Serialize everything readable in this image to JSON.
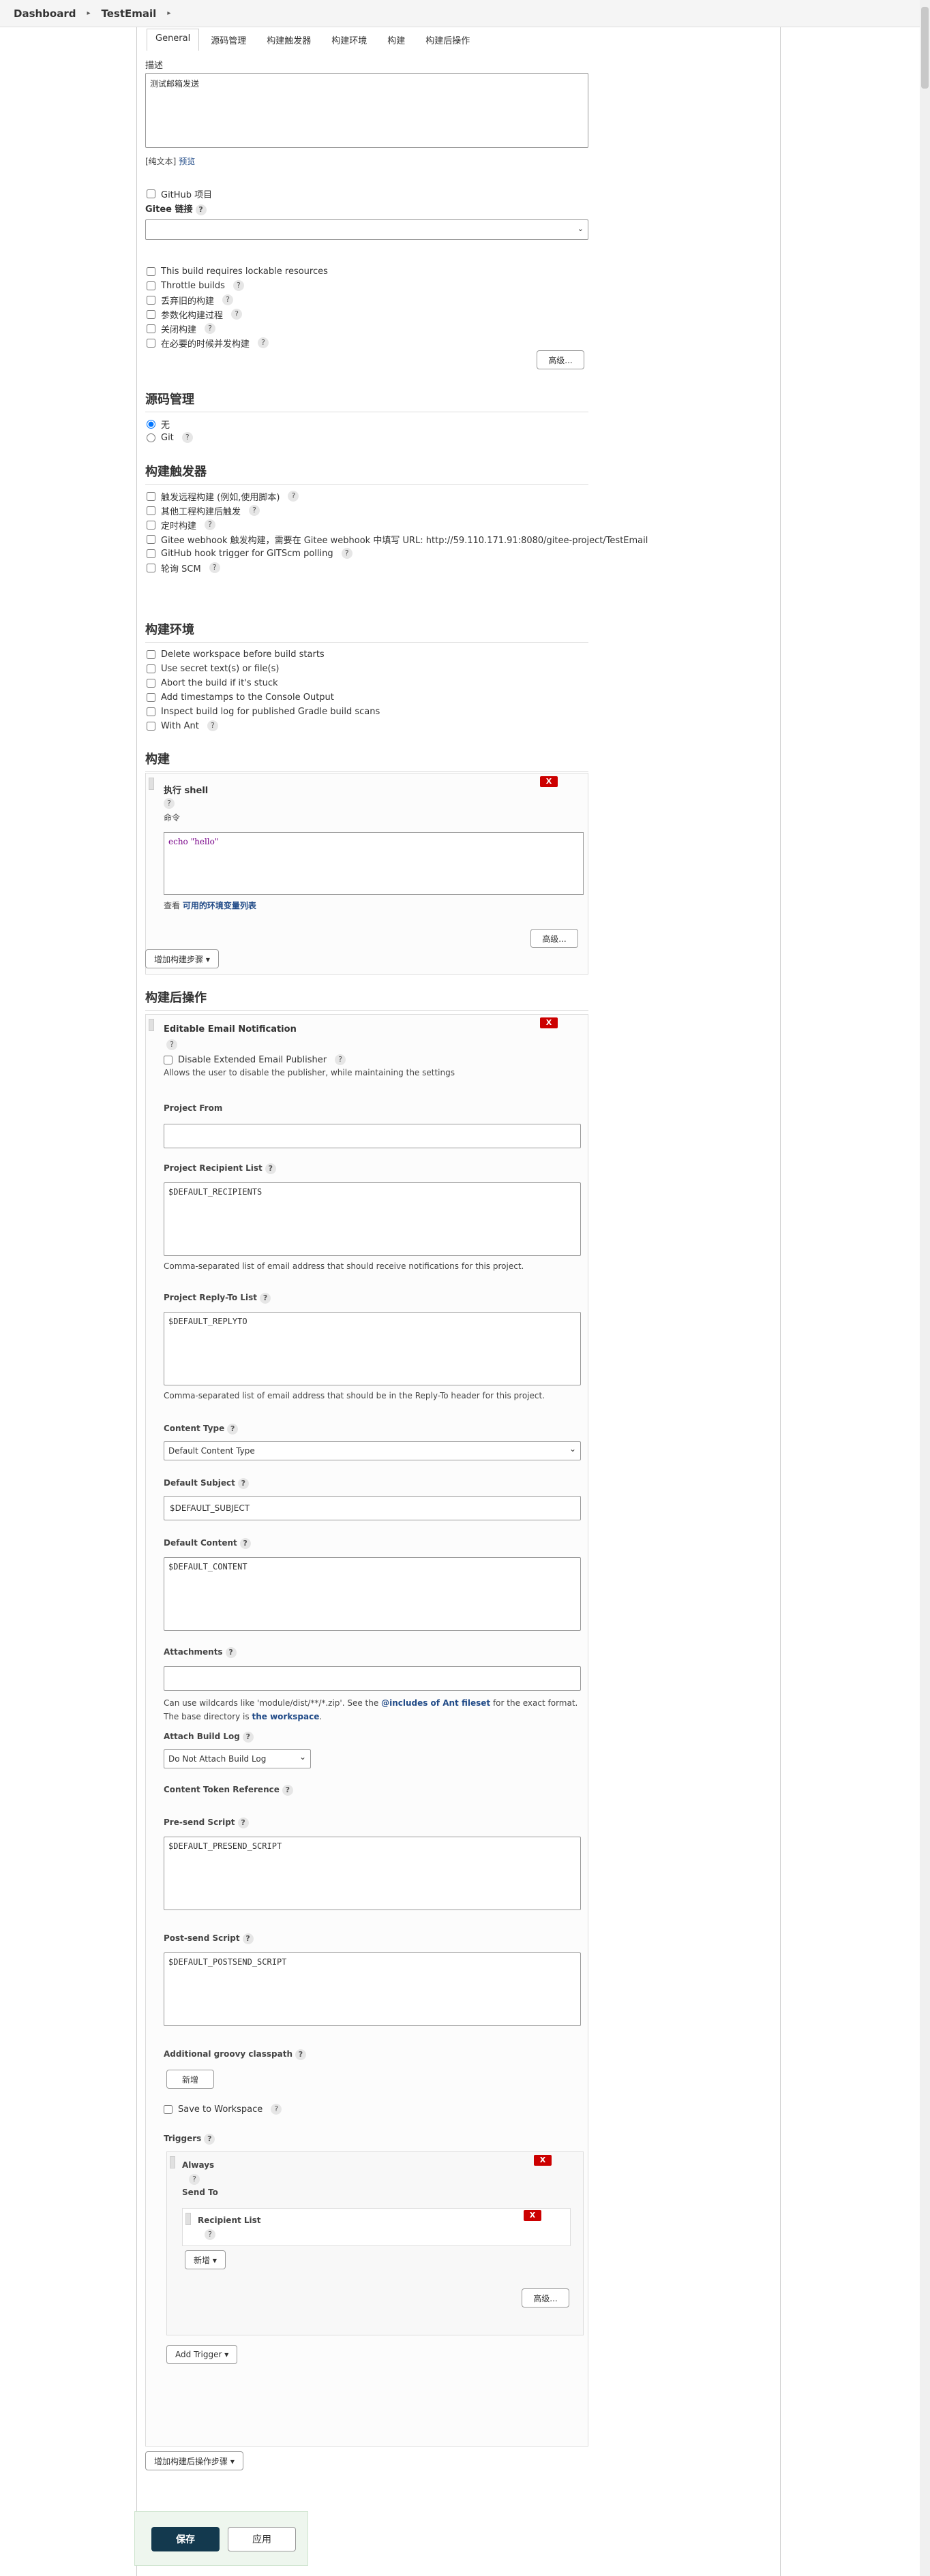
{
  "breadcrumb": {
    "dashboard": "Dashboard",
    "job": "TestEmail"
  },
  "tabs": [
    "General",
    "源码管理",
    "构建触发器",
    "构建环境",
    "构建",
    "构建后操作"
  ],
  "general": {
    "description_label": "描述",
    "description_value": "测试邮箱发送",
    "plain_text": "[纯文本]",
    "preview": "预览",
    "github_project": "GitHub 项目",
    "gitee_link": "Gitee 链接",
    "options": [
      "This build requires lockable resources",
      "Throttle builds",
      "丢弃旧的构建",
      "参数化构建过程",
      "关闭构建",
      "在必要的时候并发构建"
    ],
    "advanced": "高级..."
  },
  "scm": {
    "title": "源码管理",
    "none": "无",
    "git": "Git"
  },
  "triggers": {
    "title": "构建触发器",
    "options": [
      "触发远程构建 (例如,使用脚本)",
      "其他工程构建后触发",
      "定时构建",
      "Gitee webhook 触发构建，需要在 Gitee webhook 中填写 URL: http://59.110.171.91:8080/gitee-project/TestEmail",
      "GitHub hook trigger for GITScm polling",
      "轮询 SCM"
    ]
  },
  "env": {
    "title": "构建环境",
    "options": [
      "Delete workspace before build starts",
      "Use secret text(s) or file(s)",
      "Abort the build if it's stuck",
      "Add timestamps to the Console Output",
      "Inspect build log for published Gradle build scans",
      "With Ant"
    ]
  },
  "build": {
    "title": "构建",
    "step_title": "执行 shell",
    "command_label": "命令",
    "command": "echo \"hello\"",
    "see": "查看",
    "env_link": "可用的环境变量列表",
    "advanced": "高级...",
    "add_step": "增加构建步骤",
    "x": "X"
  },
  "post": {
    "title": "构建后操作",
    "step_title": "Editable Email Notification",
    "disable_ext": "Disable Extended Email Publisher",
    "disable_desc": "Allows the user to disable the publisher, while maintaining the settings",
    "project_from": "Project From",
    "recipient_label": "Project Recipient List",
    "recipient_value": "$DEFAULT_RECIPIENTS",
    "recipient_desc": "Comma-separated list of email address that should receive notifications for this project.",
    "replyto_label": "Project Reply-To List",
    "replyto_value": "$DEFAULT_REPLYTO",
    "replyto_desc": "Comma-separated list of email address that should be in the Reply-To header for this project.",
    "content_type_label": "Content Type",
    "content_type_value": "Default Content Type",
    "subject_label": "Default Subject",
    "subject_value": "$DEFAULT_SUBJECT",
    "content_label": "Default Content",
    "content_value": "$DEFAULT_CONTENT",
    "attachments_label": "Attachments",
    "attach_desc1": "Can use wildcards like 'module/dist/**/*.zip'. See the",
    "attach_link1": "@includes of Ant fileset",
    "attach_desc2": "for the exact format.",
    "attach_desc3": "The base directory is",
    "attach_link2": "the workspace",
    "attach_log_label": "Attach Build Log",
    "attach_log_value": "Do Not Attach Build Log",
    "token_ref": "Content Token Reference",
    "presend_label": "Pre-send Script",
    "presend_value": "$DEFAULT_PRESEND_SCRIPT",
    "postsend_label": "Post-send Script",
    "postsend_value": "$DEFAULT_POSTSEND_SCRIPT",
    "classpath_label": "Additional groovy classpath",
    "add": "新增",
    "save_ws": "Save to Workspace",
    "triggers_label": "Triggers",
    "always": "Always",
    "send_to": "Send To",
    "recipient_list": "Recipient List",
    "add_dd": "新增",
    "advanced": "高级...",
    "add_trigger": "Add Trigger",
    "add_post": "增加构建后操作步骤",
    "x": "X"
  },
  "footer": {
    "save": "保存",
    "apply": "应用"
  }
}
